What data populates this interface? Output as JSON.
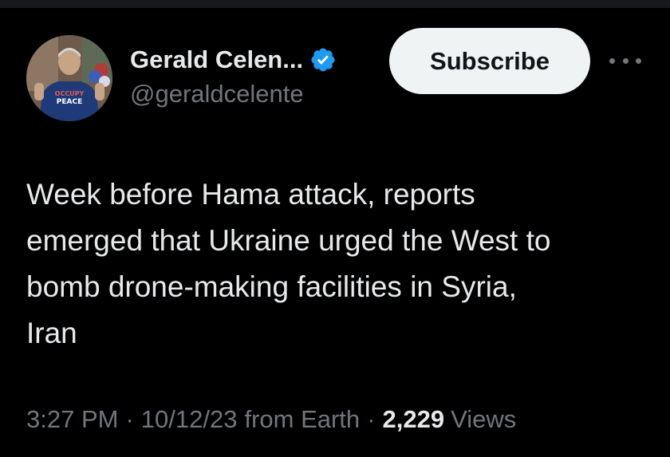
{
  "author": {
    "display_name": "Gerald Celen...",
    "handle": "@geraldcelente",
    "verified_icon": "verified-badge-icon",
    "avatar_icon": "profile-photo-avatar",
    "avatar_shirt_text": "OCCUPY PEACE"
  },
  "actions": {
    "subscribe_label": "Subscribe",
    "more_icon": "more-options-icon"
  },
  "tweet": {
    "text": "Week before Hama attack, reports\nemerged that Ukraine urged the West to\nbomb drone-making facilities in Syria,\nIran"
  },
  "meta": {
    "time": "3:27 PM",
    "separator": "·",
    "date": "10/12/23",
    "source": "from Earth",
    "views_count": "2,229",
    "views_label": "Views"
  },
  "colors": {
    "background": "#000000",
    "text_primary": "#e7e9ea",
    "text_secondary": "#71767b",
    "verified_blue": "#1d9bf0",
    "button_bg": "#eff3f4"
  }
}
